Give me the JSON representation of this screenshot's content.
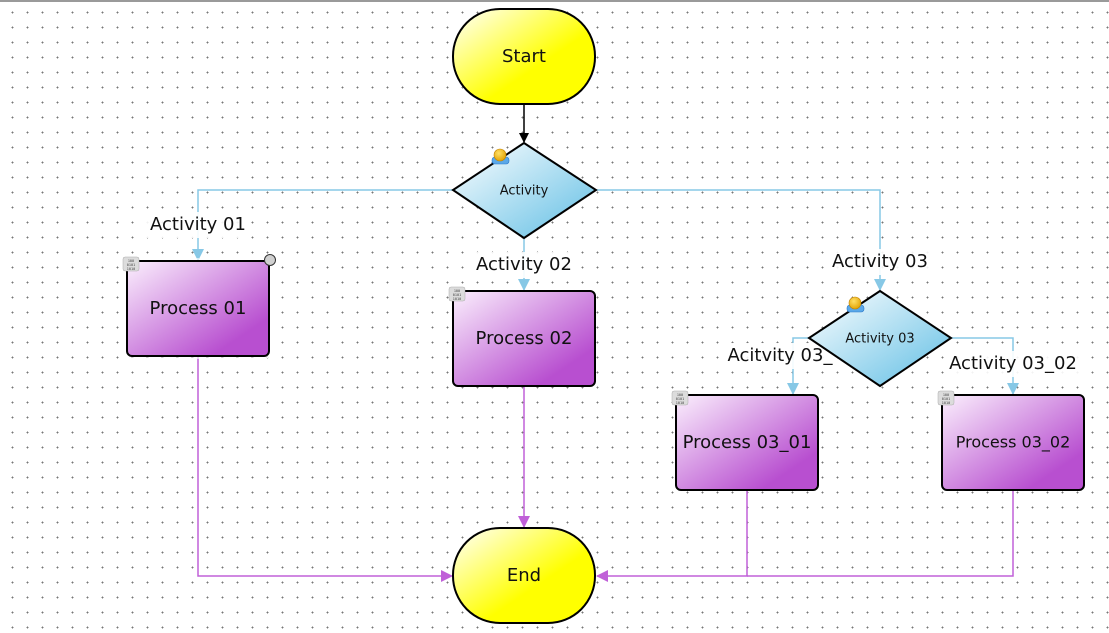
{
  "diagram": {
    "nodes": {
      "start": {
        "label": "Start",
        "type": "terminator"
      },
      "activity": {
        "label": "Activity",
        "type": "decision"
      },
      "process_01": {
        "label": "Process 01",
        "type": "process",
        "selected": true
      },
      "process_02": {
        "label": "Process 02",
        "type": "process"
      },
      "activity_03": {
        "label": "Activity 03",
        "type": "decision"
      },
      "process_03_01": {
        "label": "Process 03_01",
        "type": "process"
      },
      "process_03_02": {
        "label": "Process 03_02",
        "type": "process"
      },
      "end": {
        "label": "End",
        "type": "terminator"
      }
    },
    "edges": {
      "activity_01": {
        "label": "Activity 01",
        "from": "Activity",
        "to": "Process 01"
      },
      "activity_02": {
        "label": "Activity 02",
        "from": "Activity",
        "to": "Process 02"
      },
      "activity_03": {
        "label": "Activity 03",
        "from": "Activity",
        "to": "Activity 03"
      },
      "activity_03_01": {
        "label": "Acitvity 03_",
        "from": "Activity 03",
        "to": "Process 03_01"
      },
      "activity_03_02": {
        "label": "Activity 03_02",
        "from": "Activity 03",
        "to": "Process 03_02"
      }
    },
    "colors": {
      "terminator_fill": "#ffff00",
      "decision_fill": "#87ceeb",
      "process_fill": "#b84fd0",
      "decision_edge": "#87c8e6",
      "process_edge": "#c060d8",
      "start_edge": "#000000"
    }
  }
}
